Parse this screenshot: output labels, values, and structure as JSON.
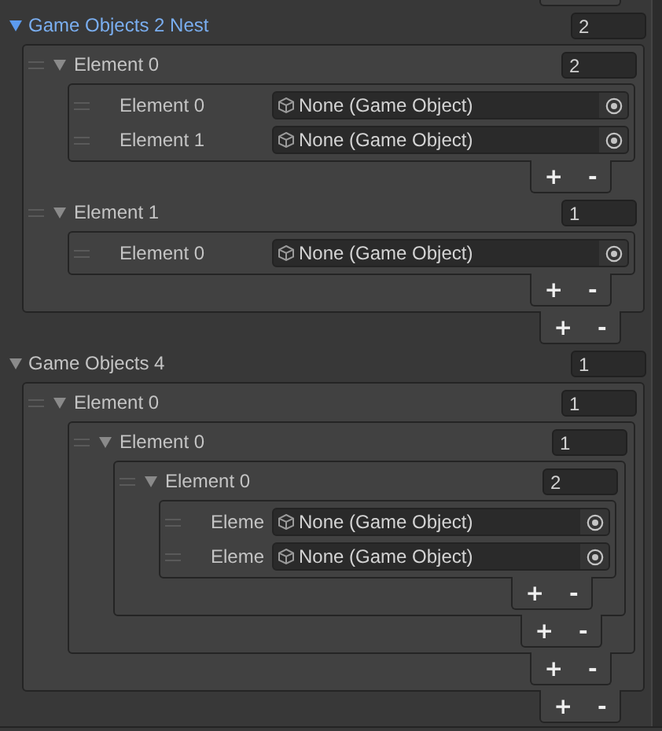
{
  "lists": [
    {
      "label": "Game Objects 2 Nest",
      "selected": true,
      "expanded": true,
      "size": "2",
      "add": "+",
      "remove": "-",
      "elements": [
        {
          "kind": "list",
          "label": "Element 0",
          "expanded": true,
          "size": "2",
          "add": "+",
          "remove": "-",
          "elements": [
            {
              "kind": "object",
              "label": "Element 0",
              "value": "None (Game Object)"
            },
            {
              "kind": "object",
              "label": "Element 1",
              "value": "None (Game Object)"
            }
          ]
        },
        {
          "kind": "list",
          "label": "Element 1",
          "expanded": true,
          "size": "1",
          "add": "+",
          "remove": "-",
          "elements": [
            {
              "kind": "object",
              "label": "Element 0",
              "value": "None (Game Object)"
            }
          ]
        }
      ]
    },
    {
      "label": "Game Objects 4",
      "selected": false,
      "expanded": true,
      "size": "1",
      "add": "+",
      "remove": "-",
      "elements": [
        {
          "kind": "list",
          "label": "Element 0",
          "expanded": true,
          "size": "1",
          "add": "+",
          "remove": "-",
          "elements": [
            {
              "kind": "list",
              "label": "Element 0",
              "expanded": true,
              "size": "1",
              "add": "+",
              "remove": "-",
              "elements": [
                {
                  "kind": "list",
                  "label": "Element 0",
                  "expanded": true,
                  "size": "2",
                  "add": "+",
                  "remove": "-",
                  "elements": [
                    {
                      "kind": "object",
                      "label": "Eleme",
                      "value": "None (Game Object)"
                    },
                    {
                      "kind": "object",
                      "label": "Eleme",
                      "value": "None (Game Object)"
                    }
                  ]
                }
              ]
            }
          ]
        }
      ]
    }
  ]
}
